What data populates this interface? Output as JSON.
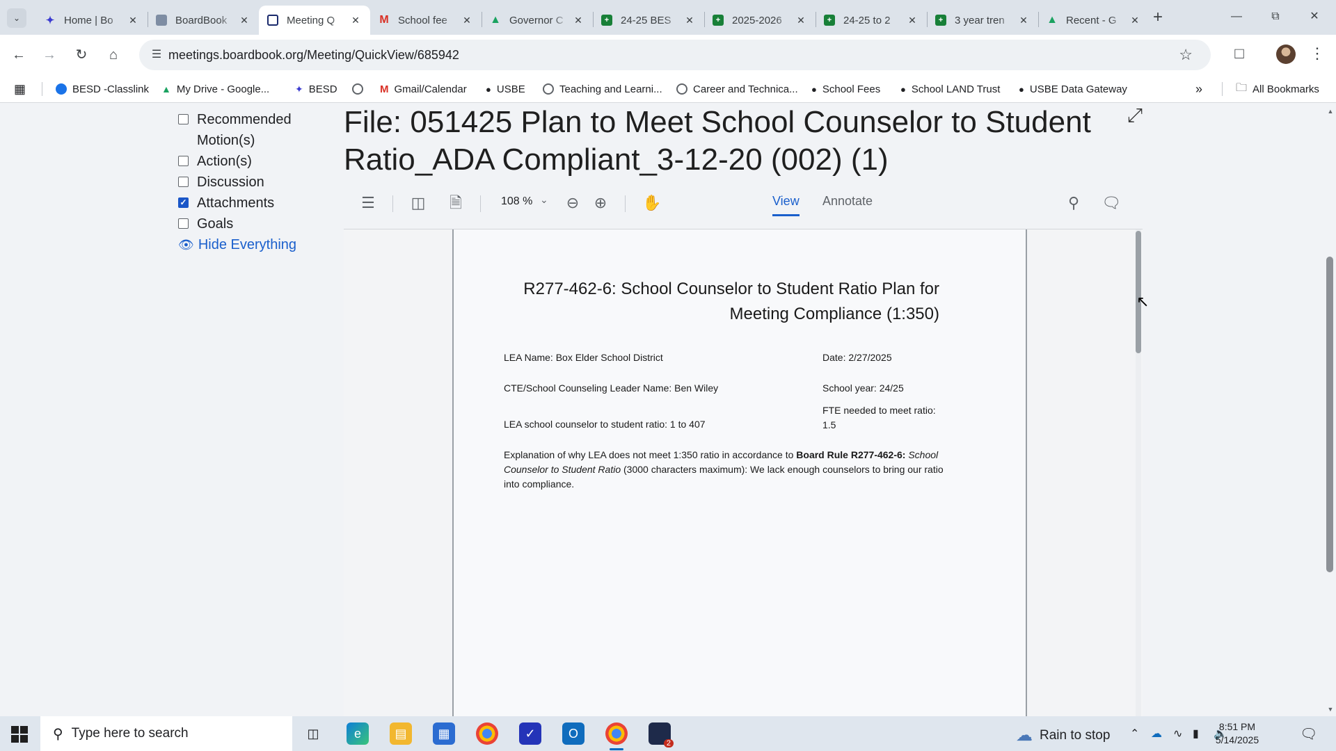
{
  "browser": {
    "tabs": [
      {
        "title": "Home | Bo",
        "favicon": "flame-icon",
        "color": "#3b3bd0",
        "active": false
      },
      {
        "title": "BoardBook",
        "favicon": "boardbook-icon",
        "color": "#7e8da3",
        "active": false
      },
      {
        "title": "Meeting Q",
        "favicon": "boardbook-active-icon",
        "color": "#1a2a6c",
        "active": true
      },
      {
        "title": "School fee",
        "favicon": "gmail-icon",
        "color": "#d93025",
        "active": false
      },
      {
        "title": "Governor C",
        "favicon": "google-drive-icon",
        "color": "#1aa260",
        "active": false
      },
      {
        "title": "24-25 BES",
        "favicon": "google-sheets-icon",
        "color": "#188038",
        "active": false
      },
      {
        "title": "2025-2026",
        "favicon": "google-sheets-icon",
        "color": "#188038",
        "active": false
      },
      {
        "title": "24-25 to 2",
        "favicon": "google-sheets-icon",
        "color": "#188038",
        "active": false
      },
      {
        "title": "3 year tren",
        "favicon": "google-sheets-icon",
        "color": "#188038",
        "active": false
      },
      {
        "title": "Recent - G",
        "favicon": "google-drive-icon",
        "color": "#1aa260",
        "active": false
      }
    ],
    "url": "meetings.boardbook.org/Meeting/QuickView/685942",
    "bookmarks": [
      {
        "label": "BESD -Classlink",
        "icon": "classlink-icon",
        "color": "#1a73e8"
      },
      {
        "label": "My Drive - Google...",
        "icon": "google-drive-icon",
        "color": "#1aa260"
      },
      {
        "label": "BESD",
        "icon": "flame-icon",
        "color": "#3b3bd0"
      },
      {
        "label": "",
        "icon": "globe-icon",
        "color": "#5f6368"
      },
      {
        "label": "Gmail/Calendar",
        "icon": "gmail-icon",
        "color": "#d93025"
      },
      {
        "label": "USBE",
        "icon": "usbe-icon",
        "color": "#202124"
      },
      {
        "label": "Teaching and Learni...",
        "icon": "globe-icon",
        "color": "#5f6368"
      },
      {
        "label": "Career and Technica...",
        "icon": "globe-icon",
        "color": "#5f6368"
      },
      {
        "label": "School Fees",
        "icon": "usbe-icon",
        "color": "#202124"
      },
      {
        "label": "School LAND Trust",
        "icon": "usbe-icon",
        "color": "#202124"
      },
      {
        "label": "USBE Data Gateway",
        "icon": "usbe-icon",
        "color": "#202124"
      }
    ],
    "all_bookmarks": "All Bookmarks"
  },
  "sidebar": {
    "items": [
      {
        "label": "Recommended\nMotion(s)",
        "checked": false
      },
      {
        "label": "Action(s)",
        "checked": false
      },
      {
        "label": "Discussion",
        "checked": false
      },
      {
        "label": "Attachments",
        "checked": true
      },
      {
        "label": "Goals",
        "checked": false
      }
    ],
    "hide_everything": "Hide Everything"
  },
  "file": {
    "title": "File:  051425 Plan to Meet School Counselor to Student Ratio_ADA Compliant_3-12-20 (002) (1)"
  },
  "viewer": {
    "zoom": "108 %",
    "tabs": [
      "View",
      "Annotate"
    ],
    "active_tab": "View"
  },
  "document": {
    "heading_line1": "R277-462-6: School Counselor to Student Ratio Plan for",
    "heading_line2": "Meeting Compliance (1:350)",
    "lea_name": "LEA Name: Box Elder School District",
    "date": "Date: 2/27/2025",
    "leader": "CTE/School Counseling Leader Name: Ben Wiley",
    "school_year": "School year: 24/25",
    "ratio": "LEA school counselor to student ratio: 1 to 407",
    "fte_line1": "FTE needed to meet ratio:",
    "fte_line2": "1.5",
    "explanation_prefix": "Explanation of why LEA does not meet 1:350 ratio in accordance to ",
    "explanation_bold": "Board Rule R277-462-6:",
    "explanation_italic": "School Counselor to Student Ratio",
    "explanation_suffix": " (3000 characters maximum):  We lack enough counselors to bring our ratio into compliance."
  },
  "taskbar": {
    "search_placeholder": "Type here to search",
    "weather": "Rain to stop",
    "time": "8:51 PM",
    "date": "5/14/2025",
    "chrome_badge": "2"
  }
}
